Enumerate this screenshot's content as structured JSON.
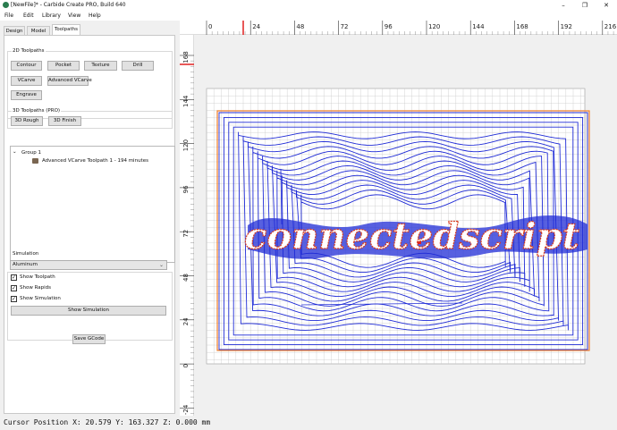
{
  "window": {
    "title": "[NewFile]* - Carbide Create PRO, Build 640",
    "icon": "carbide-logo-icon",
    "controls": [
      "minimize-icon",
      "restore-icon",
      "close-icon"
    ]
  },
  "menu": [
    "File",
    "Edit",
    "Library",
    "View",
    "Help"
  ],
  "tabs": [
    "Design",
    "Model",
    "Toolpaths"
  ],
  "active_tab": "Toolpaths",
  "toolpaths_2d": {
    "title": "2D Toolpaths",
    "buttons": [
      "Contour",
      "Pocket",
      "Texture",
      "Drill",
      "VCarve",
      "Advanced VCarve",
      "Engrave"
    ]
  },
  "toolpaths_3d": {
    "title": "3D Toolpaths (PRO)",
    "buttons": [
      "3D Rough",
      "3D Finish"
    ]
  },
  "tree": {
    "group": "Group 1",
    "item": "Advanced VCarve Toolpath 1 - 194 minutes",
    "item_icon": "toolpath-icon"
  },
  "simulation": {
    "title": "Simulation",
    "material": "Aluminum",
    "checks": [
      {
        "label": "Show Toolpath",
        "checked": true
      },
      {
        "label": "Show Rapids",
        "checked": true
      },
      {
        "label": "Show Simulation",
        "checked": true
      }
    ],
    "button": "Show Simulation"
  },
  "save_button": "Save GCode",
  "rulers": {
    "x": [
      "0",
      "24",
      "48",
      "72",
      "96",
      "120",
      "144",
      "168",
      "192",
      "216"
    ],
    "y": [
      "168",
      "144",
      "120",
      "96",
      "72",
      "48",
      "24",
      "0",
      "-24"
    ]
  },
  "colors": {
    "toolpath": "#1f2bd6",
    "stock": "#ffffff",
    "border": "#f07e2a",
    "cursor": "#e02020",
    "vcarve": "#d83a1a"
  },
  "design_text": "connectedscript",
  "status": "Cursor Position X: 20.579 Y: 163.327 Z: 0.000 mm"
}
